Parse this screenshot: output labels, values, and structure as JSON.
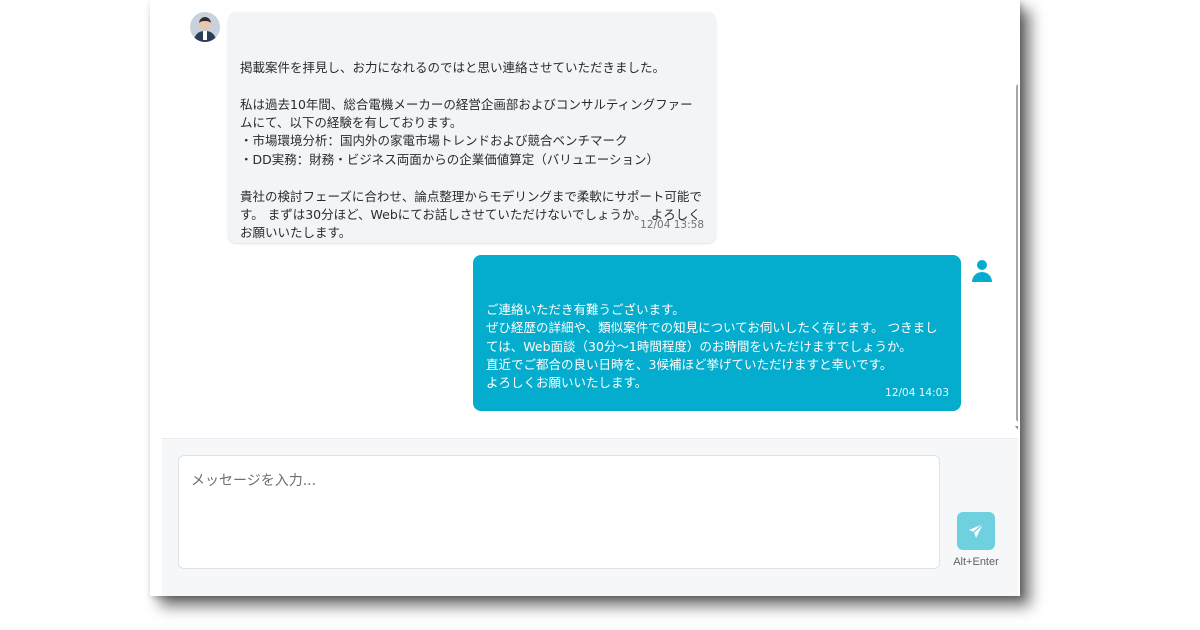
{
  "conversation": {
    "received": {
      "avatar": "businessman-photo-avatar",
      "text": "掲載案件を拝見し、お力になれるのではと思い連絡させていただきました。\n\n私は過去10年間、総合電機メーカーの経営企画部およびコンサルティングファームにて、以下の経験を有しております。\n・市場環境分析：国内外の家電市場トレンドおよび競合ベンチマーク\n・DD実務：財務・ビジネス両面からの企業価値算定（バリュエーション）\n\n貴社の検討フェーズに合わせ、論点整理からモデリングまで柔軟にサポート可能です。 まずは30分ほど、Webにてお話しさせていただけないでしょうか。 よろしくお願いいたします。",
      "timestamp": "12/04 13:58"
    },
    "sent": {
      "avatar": "user-icon",
      "text": "ご連絡いただき有難うございます。\nぜひ経歴の詳細や、類似案件での知見についてお伺いしたく存じます。 つきましては、Web面談（30分〜1時間程度）のお時間をいただけますでしょうか。\n直近でご都合の良い日時を、3候補ほど挙げていただけますと幸いです。\nよろしくお願いいたします。",
      "timestamp": "12/04 14:03"
    }
  },
  "composer": {
    "placeholder": "メッセージを入力...",
    "send_icon": "paper-plane-icon",
    "send_hint": "Alt+Enter"
  },
  "colors": {
    "accent": "#04adcd",
    "send_button": "#6fd0e0",
    "received_bubble": "#f2f4f6"
  }
}
